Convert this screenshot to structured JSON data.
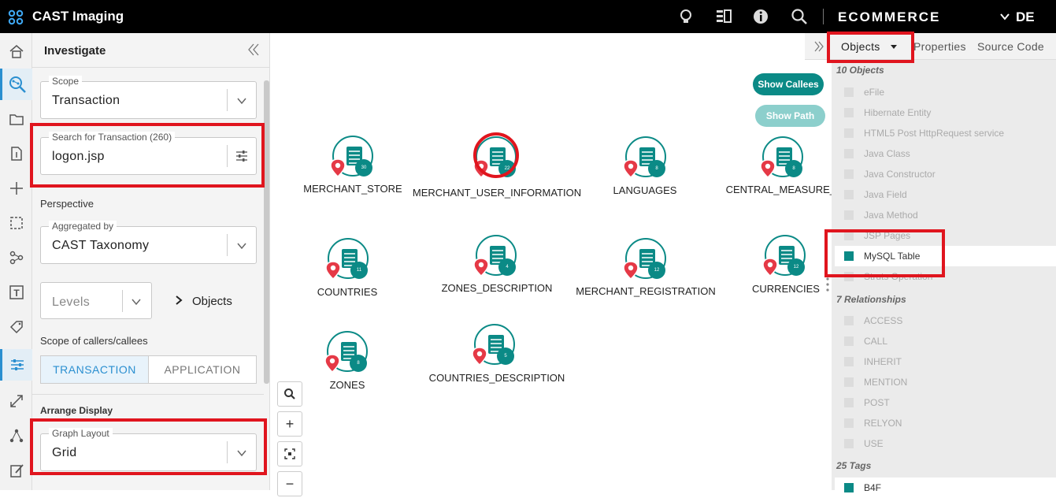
{
  "app": {
    "title": "CAST Imaging",
    "project": "ECOMMERCE",
    "extra": "DE"
  },
  "topbar_icons": [
    "lightbulb-icon",
    "view-icon",
    "info-icon",
    "search-icon"
  ],
  "iconbar": [
    "home-icon",
    "investigate-icon",
    "folder-icon",
    "file-export-icon",
    "move-icon",
    "selection-icon",
    "graph-icon",
    "text-icon",
    "tag-icon",
    "filter-settings-icon",
    "expand-icon",
    "network-icon",
    "edit-icon"
  ],
  "panel": {
    "title": "Investigate",
    "scope": {
      "legend": "Scope",
      "value": "Transaction"
    },
    "search": {
      "legend": "Search for Transaction (260)",
      "value": "logon.jsp"
    },
    "perspective_label": "Perspective",
    "aggregated": {
      "legend": "Aggregated by",
      "value": "CAST Taxonomy"
    },
    "levels": {
      "placeholder": "Levels"
    },
    "objects_link": "Objects",
    "scope_callers_label": "Scope of callers/callees",
    "segment": [
      "TRANSACTION",
      "APPLICATION"
    ],
    "arrange_label": "Arrange Display",
    "graph_layout": {
      "legend": "Graph Layout",
      "value": "Grid"
    }
  },
  "canvas": {
    "buttons": {
      "show_callees": "Show Callees",
      "show_path": "Show Path"
    },
    "nodes": [
      {
        "label": "MERCHANT_STORE",
        "count": "30"
      },
      {
        "label": "MERCHANT_USER_INFORMATION",
        "count": "22"
      },
      {
        "label": "LANGUAGES",
        "count": "8"
      },
      {
        "label": "CENTRAL_MEASURE_U",
        "count": "8"
      },
      {
        "label": "COUNTRIES",
        "count": "11"
      },
      {
        "label": "ZONES_DESCRIPTION",
        "count": "4"
      },
      {
        "label": "MERCHANT_REGISTRATION",
        "count": "12"
      },
      {
        "label": "CURRENCIES",
        "count": "12"
      },
      {
        "label": "ZONES",
        "count": "8"
      },
      {
        "label": "COUNTRIES_DESCRIPTION",
        "count": "5"
      }
    ],
    "zoom": [
      "+",
      "−"
    ]
  },
  "right_panel": {
    "tabs": [
      "Objects",
      "Properties",
      "Source Code"
    ],
    "objects_heading": "10 Objects",
    "objects": [
      "eFile",
      "Hibernate Entity",
      "HTML5 Post HttpRequest service",
      "Java Class",
      "Java Constructor",
      "Java Field",
      "Java Method",
      "JSP Pages",
      "MySQL Table",
      "Struts Operation"
    ],
    "relationships_heading": "7 Relationships",
    "relationships": [
      "ACCESS",
      "CALL",
      "INHERIT",
      "MENTION",
      "POST",
      "RELYON",
      "USE"
    ],
    "tags_heading": "25 Tags",
    "tags": [
      "B4F"
    ]
  },
  "colors": {
    "teal": "#0b8a86",
    "highlight_red": "#e0151e",
    "accent_blue": "#2a8fd0"
  }
}
